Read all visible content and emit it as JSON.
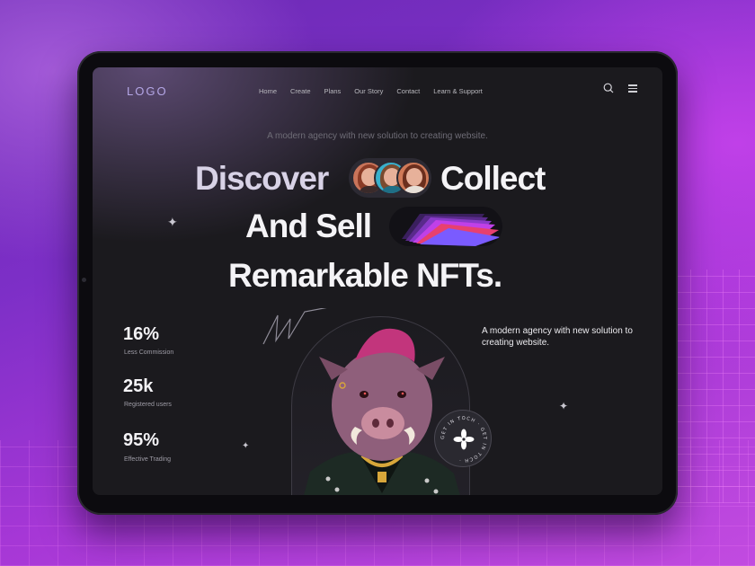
{
  "header": {
    "logo": "LOGO",
    "nav": [
      "Home",
      "Create",
      "Plans",
      "Our Story",
      "Contact",
      "Learn & Support"
    ]
  },
  "hero": {
    "tagline": "A modern agency with new solution to creating website.",
    "line1_a": "Discover",
    "line1_b": "Collect",
    "line2": "And Sell",
    "line3": "Remarkable NFTs."
  },
  "stats": [
    {
      "value": "16%",
      "label": "Less Commission"
    },
    {
      "value": "25k",
      "label": "Registered users"
    },
    {
      "value": "95%",
      "label": "Effective Trading"
    }
  ],
  "intro_right": "A modern agency with new solution to creating website.",
  "badge": {
    "text": "GET IN TOCH · GET IN TOCH · "
  },
  "icons": {
    "search": "search-icon",
    "menu": "menu-icon",
    "sparkle": "sparkle-icon"
  },
  "colors": {
    "accent": "#b4a6e6",
    "background": "#1b1a1e"
  }
}
